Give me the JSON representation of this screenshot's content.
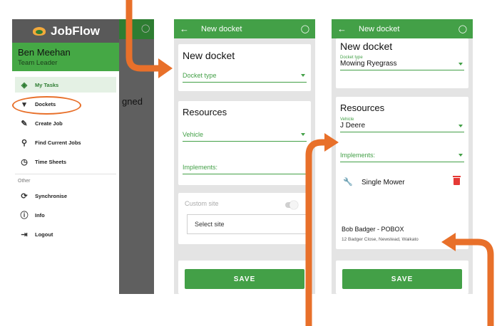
{
  "colors": {
    "accent_green": "#43a047",
    "annotation_orange": "#e8702a",
    "delete_red": "#e53935"
  },
  "screen1": {
    "app_name": "JobFlow",
    "user": {
      "name": "Ben Meehan",
      "role": "Team Leader"
    },
    "menu": [
      {
        "label": "My Tasks",
        "icon": "layers-icon"
      },
      {
        "label": "Dockets",
        "icon": "dockets-icon"
      },
      {
        "label": "Create Job",
        "icon": "edit-icon"
      },
      {
        "label": "Find Current Jobs",
        "icon": "search-icon"
      },
      {
        "label": "Time Sheets",
        "icon": "clock-icon"
      }
    ],
    "section_other": "Other",
    "other_menu": [
      {
        "label": "Synchronise",
        "icon": "sync-icon"
      },
      {
        "label": "Info",
        "icon": "info-icon"
      },
      {
        "label": "Logout",
        "icon": "logout-icon"
      }
    ],
    "background_text": "gned"
  },
  "screen2": {
    "title": "New docket",
    "docket_heading": "New docket",
    "docket_type_placeholder": "Docket type",
    "resources_heading": "Resources",
    "vehicle_placeholder": "Vehicle",
    "implements_placeholder": "Implements:",
    "custom_site_label": "Custom site",
    "select_site_label": "Select site",
    "save_label": "SAVE"
  },
  "screen3": {
    "title": "New docket",
    "docket_heading": "New docket",
    "docket_type_label": "Docket type",
    "docket_type_value": "Mowing Ryegrass",
    "resources_heading": "Resources",
    "vehicle_label": "Vehicle",
    "vehicle_value": "J Deere",
    "implements_placeholder": "Implements:",
    "implement_item": "Single Mower",
    "site_name": "Bob Badger - POBOX",
    "site_address": "12 Badger Close, Newstead, Waikato",
    "save_label": "SAVE"
  }
}
